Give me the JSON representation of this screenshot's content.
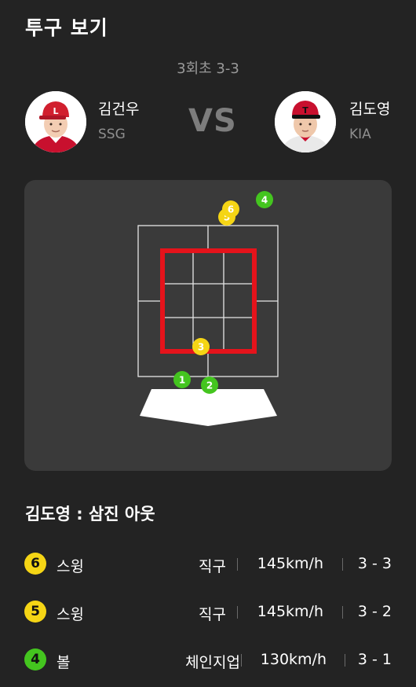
{
  "header": {
    "title": "투구 보기",
    "inning": "3회초 3-3",
    "vs": "VS"
  },
  "pitcher": {
    "name": "김건우",
    "team": "SSG",
    "photo": "player-photo-ssg"
  },
  "batter": {
    "name": "김도영",
    "team": "KIA",
    "photo": "player-photo-kia"
  },
  "strike_zone": {
    "pitches": [
      {
        "no": "1",
        "color": "green"
      },
      {
        "no": "2",
        "color": "green"
      },
      {
        "no": "3",
        "color": "yellow"
      },
      {
        "no": "4",
        "color": "green"
      },
      {
        "no": "5",
        "color": "yellow"
      },
      {
        "no": "6",
        "color": "yellow"
      }
    ]
  },
  "result": {
    "text": "김도영 : 삼진 아웃"
  },
  "pitch_log": [
    {
      "no": "6",
      "color": "yellow",
      "call": "스윙",
      "type": "직구",
      "speed": "145km/h",
      "count": "3 - 3"
    },
    {
      "no": "5",
      "color": "yellow",
      "call": "스윙",
      "type": "직구",
      "speed": "145km/h",
      "count": "3 - 2"
    },
    {
      "no": "4",
      "color": "green",
      "call": "볼",
      "type": "체인지업",
      "speed": "130km/h",
      "count": "3 - 1"
    }
  ],
  "colors": {
    "yellow": "#f5d515",
    "green": "#44c51f",
    "zone_red": "#e5131b",
    "background": "#232323",
    "panel": "#3a3a3a"
  }
}
